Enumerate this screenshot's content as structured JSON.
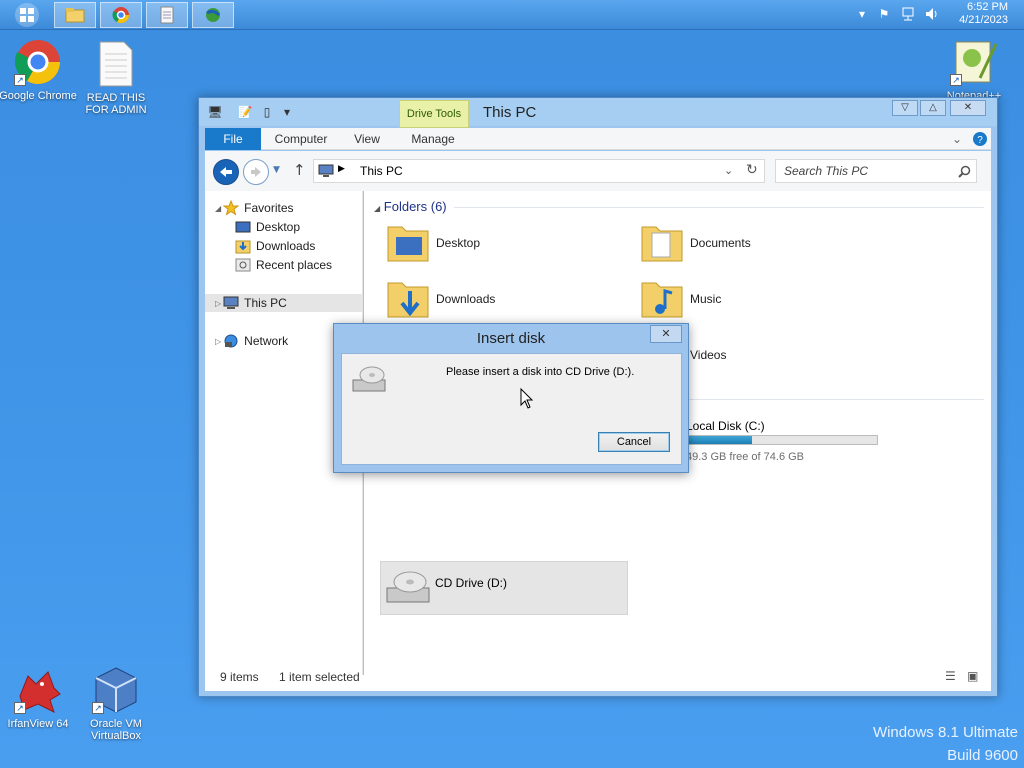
{
  "taskbar": {
    "clock_time": "6:52 PM",
    "clock_date": "4/21/2023",
    "pinned": [
      {
        "name": "file-explorer"
      },
      {
        "name": "chrome"
      },
      {
        "name": "notepad"
      },
      {
        "name": "network-app"
      }
    ]
  },
  "desktop": {
    "icons": {
      "chrome": "Google Chrome",
      "readme_line1": "READ THIS",
      "readme_line2": "FOR ADMIN",
      "notepad": "Notepad++",
      "irfanview": "IrfanView 64",
      "vbox_line1": "Oracle VM",
      "vbox_line2": "VirtualBox"
    },
    "watermark_line1": "Windows 8.1 Ultimate",
    "watermark_line2": "Build 9600"
  },
  "explorer": {
    "title": "This PC",
    "drive_tools": "Drive Tools",
    "tabs": {
      "file": "File",
      "computer": "Computer",
      "view": "View",
      "manage": "Manage"
    },
    "address": "This PC",
    "search_placeholder": "Search This PC",
    "nav": {
      "favorites": "Favorites",
      "desktop": "Desktop",
      "downloads": "Downloads",
      "recent": "Recent places",
      "this_pc": "This PC",
      "network": "Network"
    },
    "folders_header": "Folders (6)",
    "folders": {
      "desktop": "Desktop",
      "documents": "Documents",
      "downloads": "Downloads",
      "music": "Music",
      "videos": "Videos"
    },
    "drives": {
      "local_name": "Local Disk (C:)",
      "local_free": "49.3 GB free of 74.6 GB",
      "local_used_fraction": 0.34,
      "cd_name": "CD Drive (D:)"
    },
    "status": {
      "items": "9 items",
      "selected": "1 item selected"
    }
  },
  "dialog": {
    "title": "Insert disk",
    "message": "Please insert a disk into CD Drive (D:).",
    "cancel": "Cancel"
  }
}
